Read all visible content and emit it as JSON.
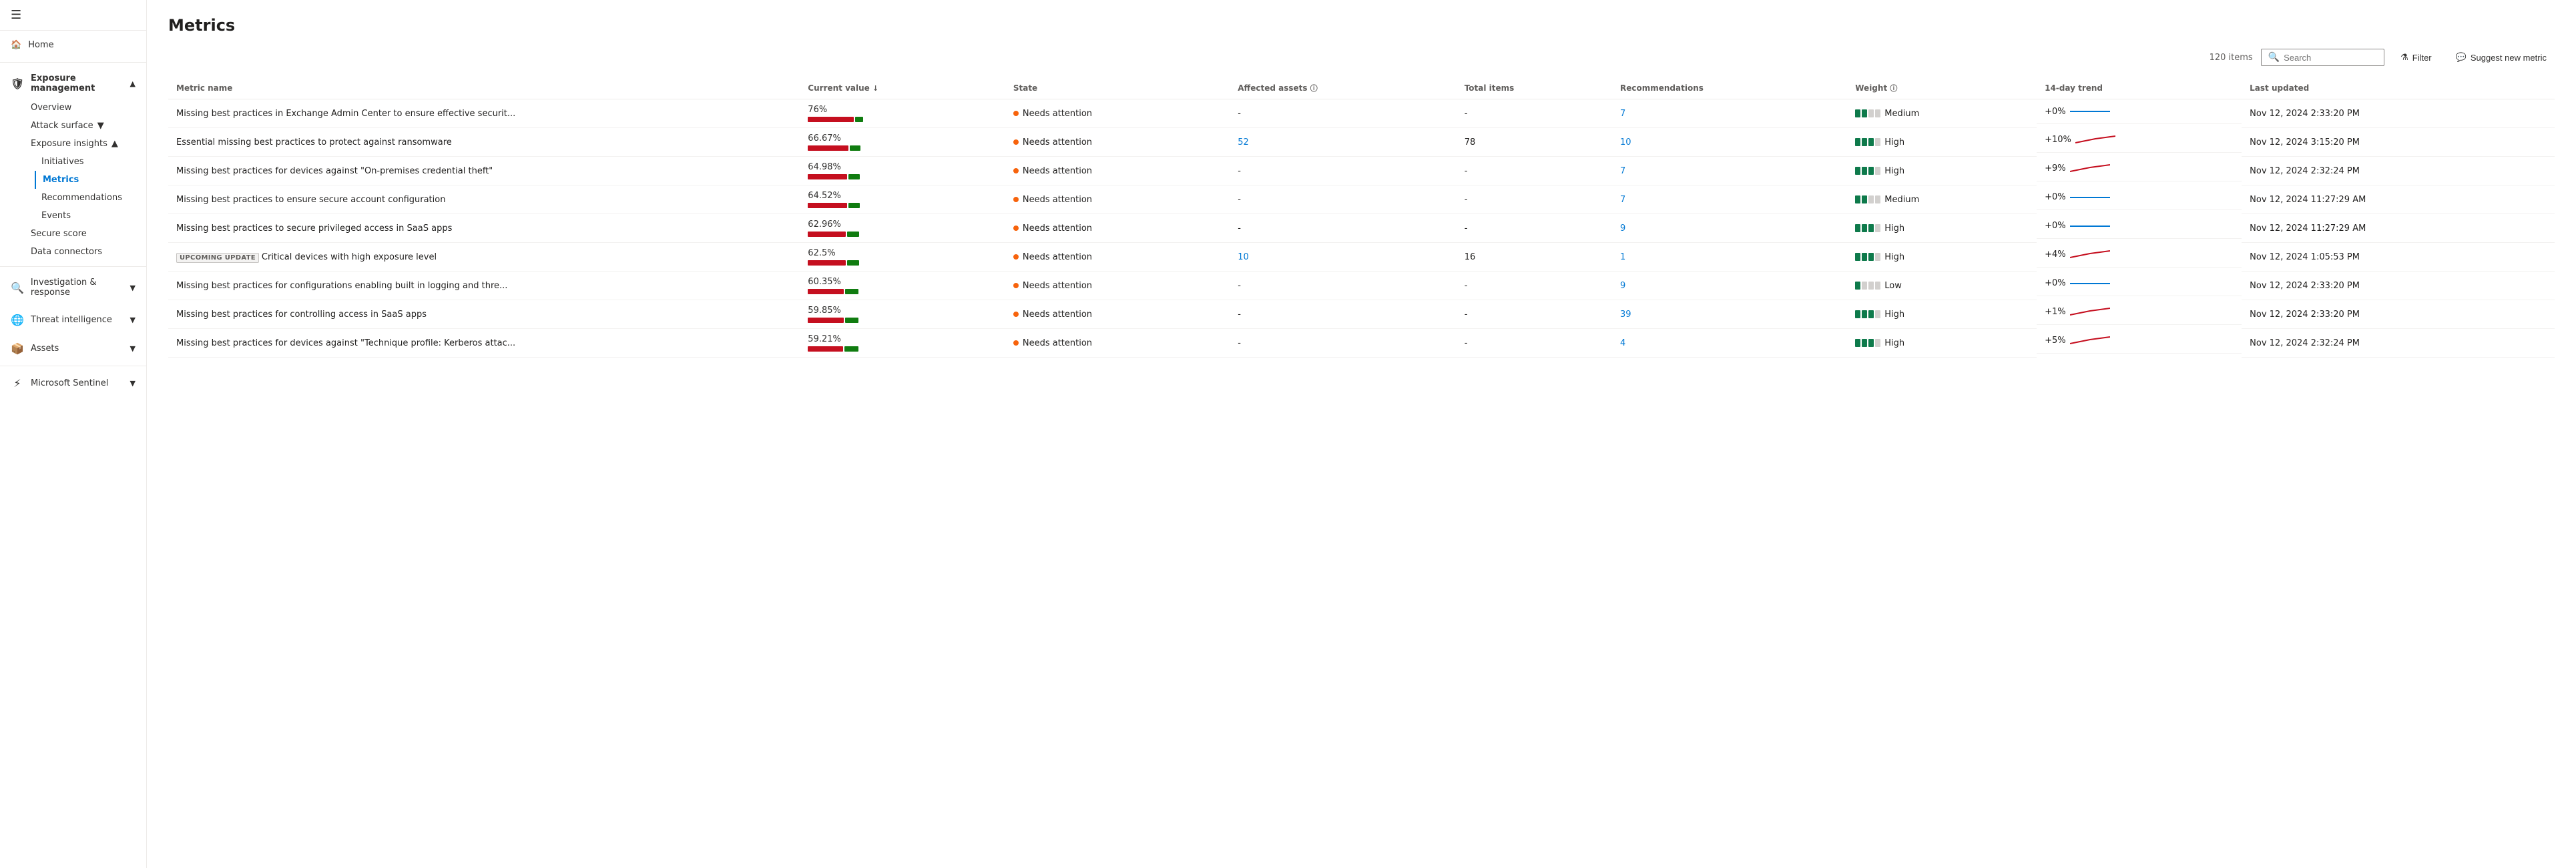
{
  "sidebar": {
    "hamburger": "☰",
    "home_label": "Home",
    "exposure_management_label": "Exposure management",
    "overview_label": "Overview",
    "attack_surface_label": "Attack surface",
    "exposure_insights_label": "Exposure insights",
    "initiatives_label": "Initiatives",
    "metrics_label": "Metrics",
    "recommendations_label": "Recommendations",
    "events_label": "Events",
    "secure_score_label": "Secure score",
    "data_connectors_label": "Data connectors",
    "investigation_response_label": "Investigation & response",
    "threat_intelligence_label": "Threat intelligence",
    "assets_label": "Assets",
    "microsoft_sentinel_label": "Microsoft Sentinel"
  },
  "toolbar": {
    "item_count": "120 items",
    "search_placeholder": "Search",
    "filter_label": "Filter",
    "suggest_label": "Suggest new metric"
  },
  "table": {
    "columns": {
      "metric_name": "Metric name",
      "current_value": "Current value",
      "state": "State",
      "affected_assets": "Affected assets",
      "total_items": "Total items",
      "recommendations": "Recommendations",
      "weight": "Weight",
      "trend": "14-day trend",
      "last_updated": "Last updated"
    },
    "rows": [
      {
        "name": "Missing best practices in Exchange Admin Center to ensure effective securit...",
        "value": "76%",
        "bar_red": 76,
        "bar_green": 24,
        "state": "Needs attention",
        "affected_assets": "-",
        "total_items": "-",
        "recommendations": "7",
        "weight": "Medium",
        "weight_filled": 2,
        "weight_total": 4,
        "trend": "+0%",
        "trend_color": "blue",
        "last_updated": "Nov 12, 2024 2:33:20 PM",
        "tag": ""
      },
      {
        "name": "Essential missing best practices to protect against ransomware",
        "value": "66.67%",
        "bar_red": 67,
        "bar_green": 33,
        "state": "Needs attention",
        "affected_assets": "52",
        "total_items": "78",
        "recommendations": "10",
        "weight": "High",
        "weight_filled": 3,
        "weight_total": 4,
        "trend": "+10%",
        "trend_color": "red",
        "last_updated": "Nov 12, 2024 3:15:20 PM",
        "tag": ""
      },
      {
        "name": "Missing best practices for devices against \"On-premises credential theft\"",
        "value": "64.98%",
        "bar_red": 65,
        "bar_green": 35,
        "state": "Needs attention",
        "affected_assets": "-",
        "total_items": "-",
        "recommendations": "7",
        "weight": "High",
        "weight_filled": 3,
        "weight_total": 4,
        "trend": "+9%",
        "trend_color": "red",
        "last_updated": "Nov 12, 2024 2:32:24 PM",
        "tag": ""
      },
      {
        "name": "Missing best practices to ensure secure account configuration",
        "value": "64.52%",
        "bar_red": 65,
        "bar_green": 35,
        "state": "Needs attention",
        "affected_assets": "-",
        "total_items": "-",
        "recommendations": "7",
        "weight": "Medium",
        "weight_filled": 2,
        "weight_total": 4,
        "trend": "+0%",
        "trend_color": "blue",
        "last_updated": "Nov 12, 2024 11:27:29 AM",
        "tag": ""
      },
      {
        "name": "Missing best practices to secure privileged access in SaaS apps",
        "value": "62.96%",
        "bar_red": 63,
        "bar_green": 37,
        "state": "Needs attention",
        "affected_assets": "-",
        "total_items": "-",
        "recommendations": "9",
        "weight": "High",
        "weight_filled": 3,
        "weight_total": 4,
        "trend": "+0%",
        "trend_color": "blue",
        "last_updated": "Nov 12, 2024 11:27:29 AM",
        "tag": ""
      },
      {
        "name": "Critical devices with high exposure level",
        "value": "62.5%",
        "bar_red": 63,
        "bar_green": 37,
        "state": "Needs attention",
        "affected_assets": "10",
        "total_items": "16",
        "recommendations": "1",
        "weight": "High",
        "weight_filled": 3,
        "weight_total": 4,
        "trend": "+4%",
        "trend_color": "red",
        "last_updated": "Nov 12, 2024 1:05:53 PM",
        "tag": "UPCOMING UPDATE"
      },
      {
        "name": "Missing best practices for configurations enabling built in logging and thre...",
        "value": "60.35%",
        "bar_red": 60,
        "bar_green": 40,
        "state": "Needs attention",
        "affected_assets": "-",
        "total_items": "-",
        "recommendations": "9",
        "weight": "Low",
        "weight_filled": 1,
        "weight_total": 4,
        "trend": "+0%",
        "trend_color": "blue",
        "last_updated": "Nov 12, 2024 2:33:20 PM",
        "tag": ""
      },
      {
        "name": "Missing best practices for controlling access in SaaS apps",
        "value": "59.85%",
        "bar_red": 60,
        "bar_green": 40,
        "state": "Needs attention",
        "affected_assets": "-",
        "total_items": "-",
        "recommendations": "39",
        "weight": "High",
        "weight_filled": 3,
        "weight_total": 4,
        "trend": "+1%",
        "trend_color": "red",
        "last_updated": "Nov 12, 2024 2:33:20 PM",
        "tag": ""
      },
      {
        "name": "Missing best practices for devices against \"Technique profile: Kerberos attac...",
        "value": "59.21%",
        "bar_red": 59,
        "bar_green": 41,
        "state": "Needs attention",
        "affected_assets": "-",
        "total_items": "-",
        "recommendations": "4",
        "weight": "High",
        "weight_filled": 3,
        "weight_total": 4,
        "trend": "+5%",
        "trend_color": "red",
        "last_updated": "Nov 12, 2024 2:32:24 PM",
        "tag": ""
      }
    ]
  }
}
